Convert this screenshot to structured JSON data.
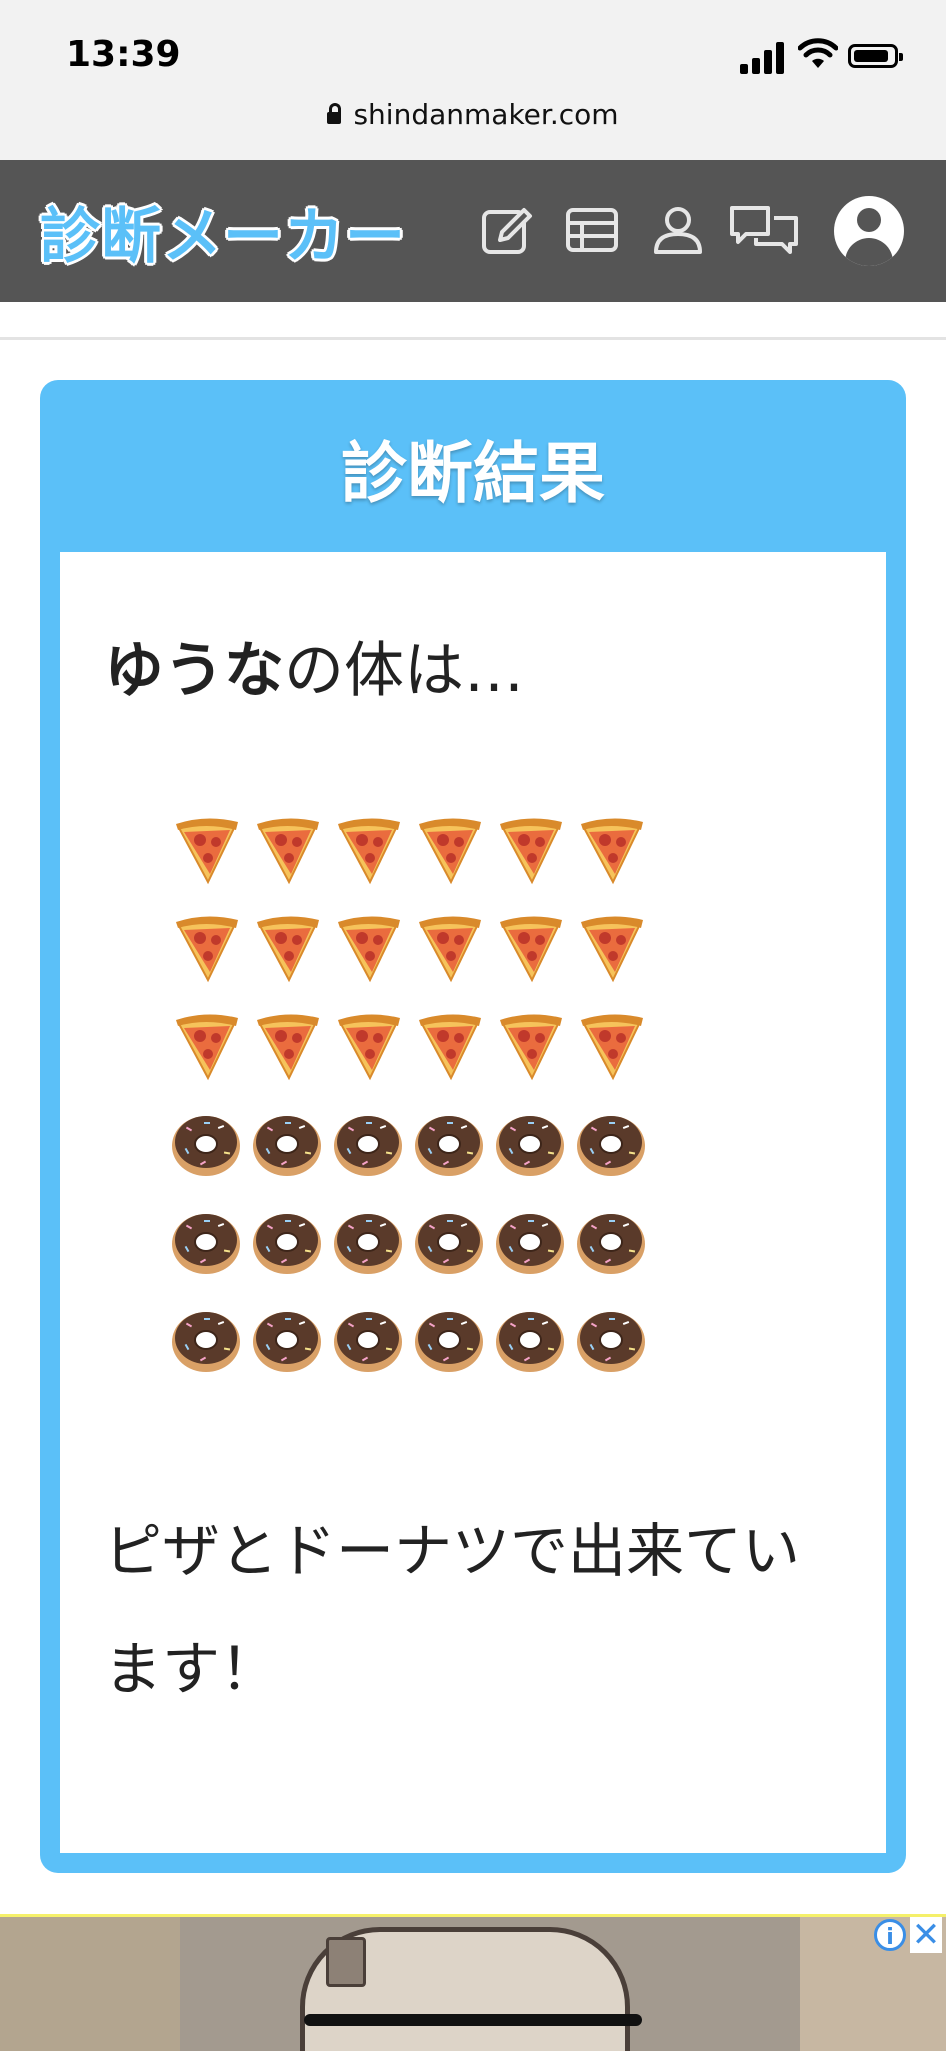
{
  "status_bar": {
    "time": "13:39"
  },
  "browser": {
    "url": "shindanmaker.com"
  },
  "site_header": {
    "logo": "診断メーカー",
    "nav_icons": [
      "edit-icon",
      "table-icon",
      "user-icon",
      "chat-icon",
      "avatar-icon"
    ]
  },
  "result_card": {
    "title": "診断結果",
    "name": "ゆうな",
    "intro_suffix": "の体は…",
    "grid_rows": [
      [
        "pizza",
        "pizza",
        "pizza",
        "pizza",
        "pizza",
        "pizza"
      ],
      [
        "pizza",
        "pizza",
        "pizza",
        "pizza",
        "pizza",
        "pizza"
      ],
      [
        "pizza",
        "pizza",
        "pizza",
        "pizza",
        "pizza",
        "pizza"
      ],
      [
        "donut",
        "donut",
        "donut",
        "donut",
        "donut",
        "donut"
      ],
      [
        "donut",
        "donut",
        "donut",
        "donut",
        "donut",
        "donut"
      ],
      [
        "donut",
        "donut",
        "donut",
        "donut",
        "donut",
        "donut"
      ]
    ],
    "result_text": "ピザとドーナツで出来ています！"
  },
  "ad": {
    "info_label": "i",
    "close_label": "✕"
  },
  "colors": {
    "accent": "#5bc0f8",
    "header_bg": "#555555",
    "ad_link": "#3a8ee6"
  }
}
